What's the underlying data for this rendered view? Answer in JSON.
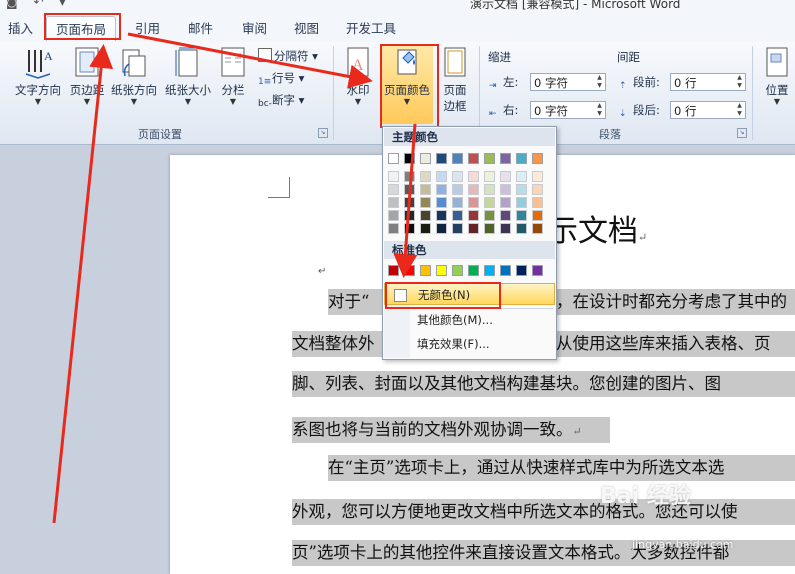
{
  "window": {
    "title": "演示文档 [兼容模式] - Microsoft Word",
    "qat_icons": [
      "save-icon",
      "undo-icon",
      "redo-icon"
    ]
  },
  "tabs": [
    {
      "label": "插入",
      "active": false
    },
    {
      "label": "页面布局",
      "active": true
    },
    {
      "label": "引用",
      "active": false
    },
    {
      "label": "邮件",
      "active": false
    },
    {
      "label": "审阅",
      "active": false
    },
    {
      "label": "视图",
      "active": false
    },
    {
      "label": "开发工具",
      "active": false
    }
  ],
  "ribbon": {
    "page_setup": {
      "label": "页面设置",
      "buttons": {
        "text_direction": "文字方向",
        "margins": "页边距",
        "orientation": "纸张方向",
        "size": "纸张大小",
        "columns": "分栏"
      },
      "small": {
        "breaks": "分隔符",
        "line_numbers": "行号",
        "hyphenation": "断字"
      }
    },
    "page_background": {
      "watermark": "水印",
      "page_color": "页面颜色",
      "page_borders_1": "页面",
      "page_borders_2": "边框"
    },
    "paragraph": {
      "label": "段落",
      "indent_label": "缩进",
      "spacing_label": "间距",
      "left_label": "左:",
      "right_label": "右:",
      "before_label": "段前:",
      "after_label": "段后:",
      "left_value": "0 字符",
      "right_value": "0 字符",
      "before_value": "0 行",
      "after_value": "0 行"
    },
    "arrange": {
      "position": "位置"
    }
  },
  "dropdown": {
    "theme_colors_header": "主题颜色",
    "standard_colors_header": "标准色",
    "no_color": "无颜色(N)",
    "more_colors": "其他颜色(M)...",
    "fill_effects": "填充效果(F)...",
    "theme_top": [
      "#ffffff",
      "#000000",
      "#eeece1",
      "#1f497d",
      "#4f81bd",
      "#c0504d",
      "#9bbb59",
      "#8064a2",
      "#4bacc6",
      "#f79646"
    ],
    "theme_shades": [
      [
        "#f2f2f2",
        "#d8d8d8",
        "#bfbfbf",
        "#a5a5a5",
        "#7f7f7f"
      ],
      [
        "#7f7f7f",
        "#595959",
        "#3f3f3f",
        "#262626",
        "#0c0c0c"
      ],
      [
        "#ddd9c3",
        "#c4bd97",
        "#938953",
        "#494429",
        "#1d1b10"
      ],
      [
        "#c6d9f0",
        "#8db3e2",
        "#548dd4",
        "#17365d",
        "#0f243e"
      ],
      [
        "#dbe5f1",
        "#b8cce4",
        "#95b3d7",
        "#366092",
        "#244061"
      ],
      [
        "#f2dcdb",
        "#e5b9b7",
        "#d99694",
        "#953734",
        "#632423"
      ],
      [
        "#ebf1dd",
        "#d7e3bc",
        "#c3d69b",
        "#76923c",
        "#4f6128"
      ],
      [
        "#e5e0ec",
        "#ccc1d9",
        "#b2a2c7",
        "#5f497a",
        "#3f3151"
      ],
      [
        "#dbeef3",
        "#b7dde8",
        "#92cddc",
        "#31859b",
        "#205867"
      ],
      [
        "#fdeada",
        "#fbd5b5",
        "#fac08f",
        "#e36c09",
        "#974806"
      ]
    ],
    "standard": [
      "#c00000",
      "#ff0000",
      "#ffc000",
      "#ffff00",
      "#92d050",
      "#00b050",
      "#00b0f0",
      "#0070c0",
      "#002060",
      "#7030a0"
    ]
  },
  "document": {
    "title": "示文档",
    "lines": [
      "对于“",
      "，在设计时都充分考虑了其中的",
      "文档整体外",
      "从使用这些库来插入表格、页",
      "脚、列表、封面以及其他文档构建基块。您创建的图片、图",
      "系图也将与当前的文档外观协调一致。",
      "在“主页”选项卡上，通过从快速样式库中为所选文本选",
      "外观，您可以方便地更改文档中所选文本的格式。您还可以使",
      "页”选项卡上的其他控件来直接设置文本格式。大多数控件都"
    ],
    "para_mark": "↵"
  },
  "watermark": {
    "text": "Bai 经验",
    "url": "jingyan.baidu.com"
  },
  "colors": {
    "annotation_red": "#e8291c",
    "hover_gold": "#ffd75a"
  }
}
